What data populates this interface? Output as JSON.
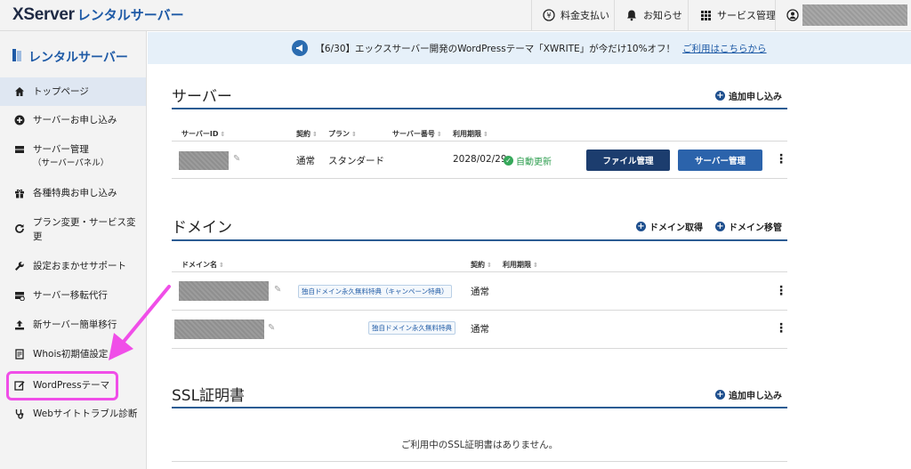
{
  "header": {
    "logo_main": "XServer",
    "logo_sub": "レンタルサーバー",
    "items": [
      {
        "label": "料金支払い",
        "icon": "yen-icon"
      },
      {
        "label": "お知らせ",
        "icon": "bell-icon"
      },
      {
        "label": "サービス管理",
        "icon": "grid-icon"
      }
    ]
  },
  "sidebar": {
    "title": "レンタルサーバー",
    "items": [
      {
        "label": "トップページ",
        "icon": "home-icon"
      },
      {
        "label": "サーバーお申し込み",
        "icon": "plus-circle-icon"
      },
      {
        "label": "サーバー管理",
        "sub": "（サーバーパネル）",
        "icon": "server-icon"
      },
      {
        "label": "各種特典お申し込み",
        "icon": "gift-icon"
      },
      {
        "label": "プラン変更・サービス変更",
        "icon": "refresh-icon"
      },
      {
        "label": "設定おまかせサポート",
        "icon": "wrench-icon"
      },
      {
        "label": "サーバー移転代行",
        "icon": "server-move-icon"
      },
      {
        "label": "新サーバー簡単移行",
        "icon": "upload-icon"
      },
      {
        "label": "Whois初期値設定",
        "icon": "document-icon"
      },
      {
        "label": "WordPressテーマ",
        "icon": "edit-icon"
      },
      {
        "label": "Webサイトトラブル診断",
        "icon": "stethoscope-icon"
      }
    ]
  },
  "notice": {
    "text": "【6/30】エックスサーバー開発のWordPressテーマ「XWRITE」が今だけ10%オフ！",
    "link": "ご利用はこちらから"
  },
  "server": {
    "title": "サーバー",
    "action": "追加申し込み",
    "columns": [
      "サーバーID",
      "契約",
      "プラン",
      "サーバー番号",
      "利用期限"
    ],
    "row": {
      "contract": "通常",
      "plan": "スタンダード",
      "expiry": "2028/02/29",
      "auto_renew": "自動更新",
      "file_button": "ファイル管理",
      "server_button": "サーバー管理"
    }
  },
  "domain": {
    "title": "ドメイン",
    "action_get": "ドメイン取得",
    "action_transfer": "ドメイン移管",
    "columns": [
      "ドメイン名",
      "契約",
      "利用期限"
    ],
    "rows": [
      {
        "tag": "独自ドメイン永久無料特典（キャンペーン特典）",
        "contract": "通常"
      },
      {
        "tag": "独自ドメイン永久無料特典",
        "contract": "通常"
      }
    ]
  },
  "ssl": {
    "title": "SSL証明書",
    "action": "追加申し込み",
    "empty": "ご利用中のSSL証明書はありません。"
  },
  "colors": {
    "accent": "#1e5aa6",
    "dark_button": "#1c3d6e",
    "mid_button": "#2b63ab",
    "highlight": "#f04ee8",
    "ok": "#36a85a"
  }
}
